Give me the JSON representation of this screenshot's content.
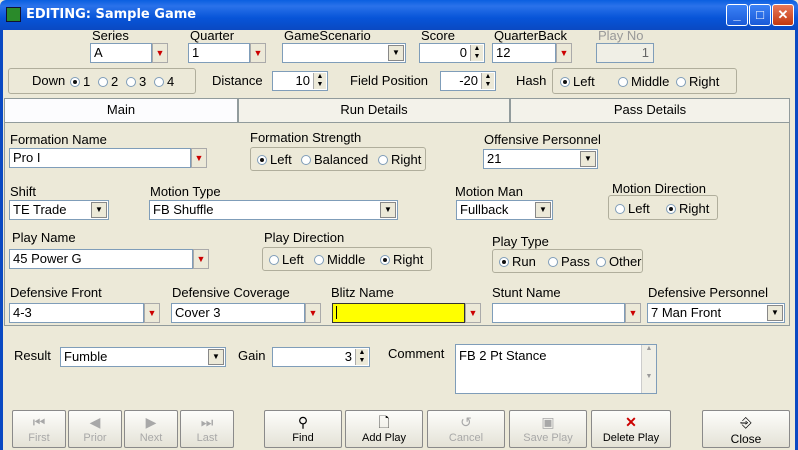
{
  "window": {
    "title": "EDITING: Sample Game",
    "min": "_",
    "max": "□",
    "close": "✕"
  },
  "header": {
    "series": {
      "label": "Series",
      "value": "A"
    },
    "quarter": {
      "label": "Quarter",
      "value": "1"
    },
    "scenario": {
      "label": "GameScenario",
      "value": ""
    },
    "score": {
      "label": "Score",
      "value": "0"
    },
    "quarterback": {
      "label": "QuarterBack",
      "value": "12"
    },
    "playno": {
      "label": "Play No",
      "value": "1"
    },
    "down": {
      "label": "Down",
      "options": [
        "1",
        "2",
        "3",
        "4"
      ],
      "selected": "1"
    },
    "distance": {
      "label": "Distance",
      "value": "10"
    },
    "fieldpos": {
      "label": "Field Position",
      "value": "-20"
    },
    "hash": {
      "label": "Hash",
      "options": [
        "Left",
        "Middle",
        "Right"
      ],
      "selected": "Left"
    }
  },
  "tabs": [
    "Main",
    "Run Details",
    "Pass Details"
  ],
  "main": {
    "formation_name": {
      "label": "Formation Name",
      "value": "Pro I"
    },
    "formation_strength": {
      "label": "Formation Strength",
      "options": [
        "Left",
        "Balanced",
        "Right"
      ],
      "selected": "Left"
    },
    "offensive_personnel": {
      "label": "Offensive Personnel",
      "value": "21"
    },
    "shift": {
      "label": "Shift",
      "value": "TE Trade"
    },
    "motion_type": {
      "label": "Motion Type",
      "value": "FB Shuffle"
    },
    "motion_man": {
      "label": "Motion Man",
      "value": "Fullback"
    },
    "motion_direction": {
      "label": "Motion Direction",
      "options": [
        "Left",
        "Right"
      ],
      "selected": "Right"
    },
    "play_name": {
      "label": "Play Name",
      "value": "45 Power G"
    },
    "play_direction": {
      "label": "Play Direction",
      "options": [
        "Left",
        "Middle",
        "Right"
      ],
      "selected": "Right"
    },
    "play_type": {
      "label": "Play Type",
      "options": [
        "Run",
        "Pass",
        "Other"
      ],
      "selected": "Run"
    },
    "defensive_front": {
      "label": "Defensive Front",
      "value": "4-3"
    },
    "defensive_coverage": {
      "label": "Defensive Coverage",
      "value": "Cover 3"
    },
    "blitz_name": {
      "label": "Blitz Name",
      "value": ""
    },
    "stunt_name": {
      "label": "Stunt Name",
      "value": ""
    },
    "defensive_personnel": {
      "label": "Defensive Personnel",
      "value": "7 Man Front"
    }
  },
  "footer": {
    "result": {
      "label": "Result",
      "value": "Fumble"
    },
    "gain": {
      "label": "Gain",
      "value": "3"
    },
    "comment": {
      "label": "Comment",
      "value": "FB 2 Pt Stance"
    }
  },
  "buttons": [
    {
      "label": "First",
      "icon": "first-icon",
      "enabled": false
    },
    {
      "label": "Prior",
      "icon": "prior-icon",
      "enabled": false
    },
    {
      "label": "Next",
      "icon": "next-icon",
      "enabled": false
    },
    {
      "label": "Last",
      "icon": "last-icon",
      "enabled": false
    },
    {
      "label": "Find",
      "icon": "binoculars-icon",
      "enabled": true
    },
    {
      "label": "Add Play",
      "icon": "new-doc-icon",
      "enabled": true
    },
    {
      "label": "Cancel",
      "icon": "cancel-icon",
      "enabled": false
    },
    {
      "label": "Save Play",
      "icon": "floppy-icon",
      "enabled": false
    },
    {
      "label": "Delete Play",
      "icon": "delete-icon",
      "enabled": true
    },
    {
      "label": "Close",
      "icon": "exit-icon",
      "enabled": true
    }
  ],
  "colors": {
    "titlebar": "#0a5fe0",
    "highlight_input": "#ffff00",
    "dropdown_accent": "#cc0000"
  }
}
